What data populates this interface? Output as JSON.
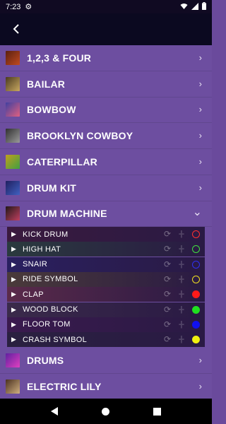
{
  "status_bar": {
    "time": "7:23"
  },
  "list": {
    "top_items": [
      {
        "label": "1,2,3 & FOUR",
        "thumb_colors": [
          "#5a2010",
          "#c04a20"
        ]
      },
      {
        "label": "BAILAR",
        "thumb_colors": [
          "#4a3a20",
          "#c8a860"
        ]
      },
      {
        "label": "BOWBOW",
        "thumb_colors": [
          "#4040a0",
          "#e06080"
        ]
      },
      {
        "label": "BROOKLYN COWBOY",
        "thumb_colors": [
          "#303030",
          "#9a9a9a"
        ]
      },
      {
        "label": "CATERPILLAR",
        "thumb_colors": [
          "#c0a020",
          "#40a040"
        ]
      },
      {
        "label": "DRUM KIT",
        "thumb_colors": [
          "#202060",
          "#4060c0"
        ]
      },
      {
        "label": "DRUM MACHINE",
        "thumb_colors": [
          "#201818",
          "#c04060"
        ]
      }
    ],
    "expanded_label": "DRUM MACHINE",
    "sub_items": [
      {
        "label": "KICK DRUM",
        "color": "#ff3030",
        "filled": false,
        "bg": "#3a1a3e"
      },
      {
        "label": "HIGH HAT",
        "color": "#40e040",
        "filled": false,
        "bg": "#2a3a3e"
      },
      {
        "label": "SNAIR",
        "color": "#3030f0",
        "filled": false,
        "bg": "#2a2060"
      },
      {
        "label": "RIDE SYMBOL",
        "color": "#f0e020",
        "filled": false,
        "bg": "#4a3a3a"
      },
      {
        "label": "CLAP",
        "color": "#ff1a1a",
        "filled": true,
        "bg": "#5a2a4a"
      },
      {
        "label": "WOOD BLOCK",
        "color": "#20e020",
        "filled": true,
        "bg": "#3a2a4a"
      },
      {
        "label": "FLOOR TOM",
        "color": "#1010f0",
        "filled": true,
        "bg": "#3a1a4e"
      },
      {
        "label": "CRASH SYMBOL",
        "color": "#f0f010",
        "filled": true,
        "bg": "#2a2040"
      }
    ],
    "bottom_items": [
      {
        "label": "DRUMS",
        "thumb_colors": [
          "#6020a0",
          "#e040c0"
        ]
      },
      {
        "label": "ELECTRIC LILY",
        "thumb_colors": [
          "#4a3020",
          "#d0b080"
        ]
      }
    ]
  }
}
